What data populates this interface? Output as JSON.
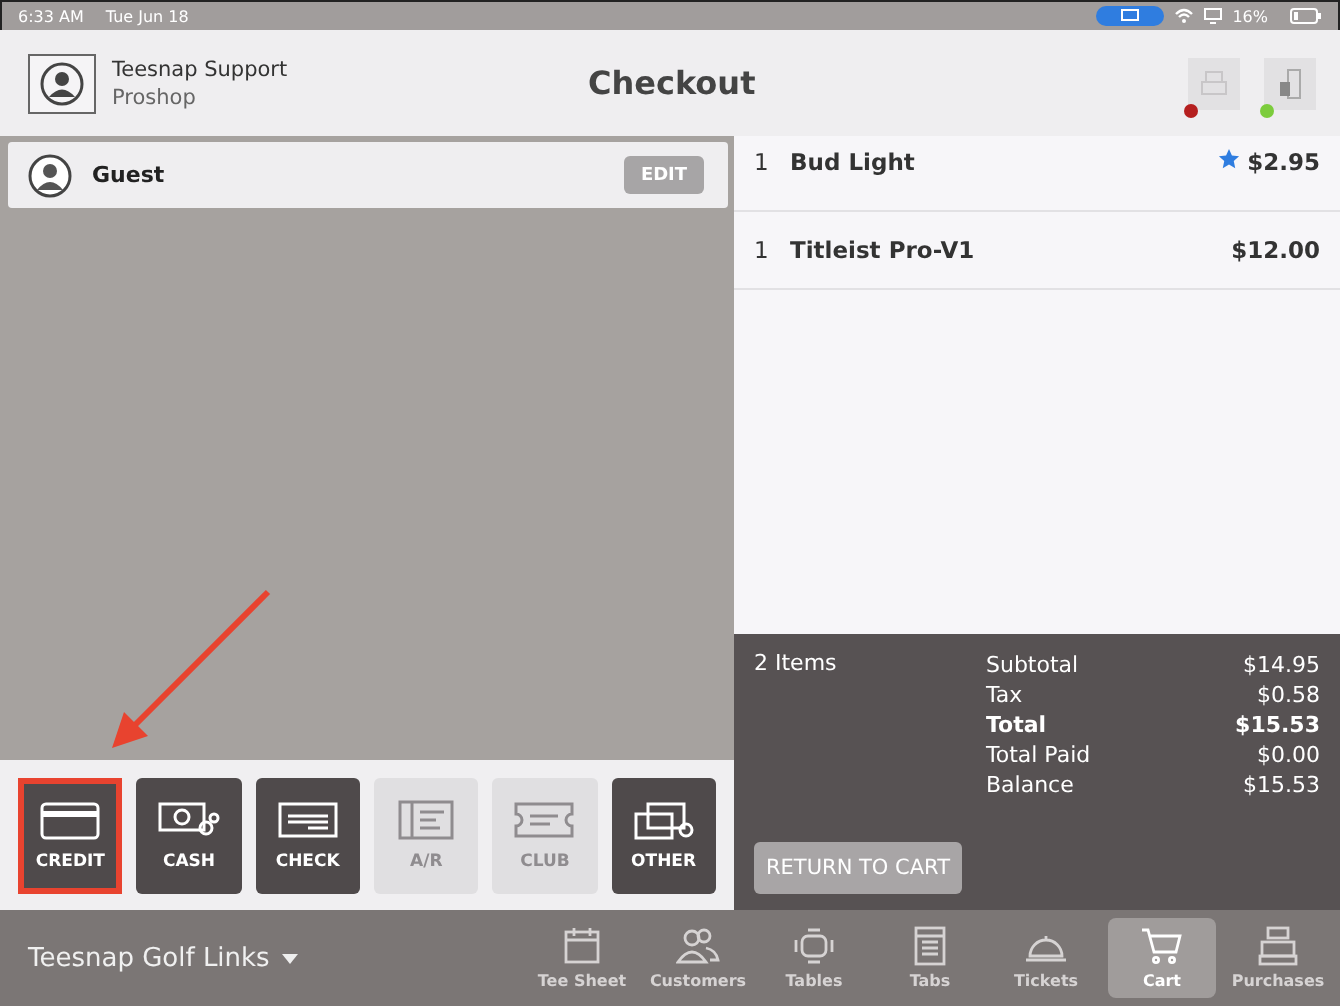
{
  "status_bar": {
    "time": "6:33 AM",
    "date": "Tue Jun 18",
    "battery": "16%"
  },
  "header": {
    "user_name": "Teesnap Support",
    "user_role": "Proshop",
    "title": "Checkout",
    "devices": [
      {
        "kind": "printer",
        "color": "#b51f1f"
      },
      {
        "kind": "drawer",
        "color": "#7ccc3c"
      }
    ]
  },
  "customer": {
    "name": "Guest",
    "edit_label": "EDIT"
  },
  "items": [
    {
      "qty": "1",
      "name": "Bud Light",
      "price": "$2.95",
      "starred": true
    },
    {
      "qty": "1",
      "name": "Titleist Pro-V1",
      "price": "$12.00",
      "starred": false
    }
  ],
  "summary": {
    "count": "2 Items",
    "lines": [
      {
        "label": "Subtotal",
        "value": "$14.95",
        "bold": false
      },
      {
        "label": "Tax",
        "value": "$0.58",
        "bold": false
      },
      {
        "label": "Total",
        "value": "$15.53",
        "bold": true
      },
      {
        "label": "Total Paid",
        "value": "$0.00",
        "bold": false
      },
      {
        "label": "Balance",
        "value": "$15.53",
        "bold": false
      }
    ],
    "return_label": "RETURN TO CART"
  },
  "payment_methods": [
    {
      "kind": "card",
      "label": "CREDIT",
      "disabled": false,
      "highlighted": true
    },
    {
      "kind": "cash",
      "label": "CASH",
      "disabled": false,
      "highlighted": false
    },
    {
      "kind": "check",
      "label": "CHECK",
      "disabled": false,
      "highlighted": false
    },
    {
      "kind": "ledger",
      "label": "A/R",
      "disabled": true,
      "highlighted": false
    },
    {
      "kind": "ticket",
      "label": "CLUB",
      "disabled": true,
      "highlighted": false
    },
    {
      "kind": "cards",
      "label": "OTHER",
      "disabled": false,
      "highlighted": false
    }
  ],
  "course": {
    "name": "Teesnap Golf Links"
  },
  "nav": [
    {
      "kind": "calendar",
      "label": "Tee Sheet",
      "selected": false
    },
    {
      "kind": "people",
      "label": "Customers",
      "selected": false
    },
    {
      "kind": "table",
      "label": "Tables",
      "selected": false
    },
    {
      "kind": "tabs",
      "label": "Tabs",
      "selected": false
    },
    {
      "kind": "bell",
      "label": "Tickets",
      "selected": false
    },
    {
      "kind": "cart",
      "label": "Cart",
      "selected": true
    },
    {
      "kind": "register",
      "label": "Purchases",
      "selected": false
    }
  ]
}
